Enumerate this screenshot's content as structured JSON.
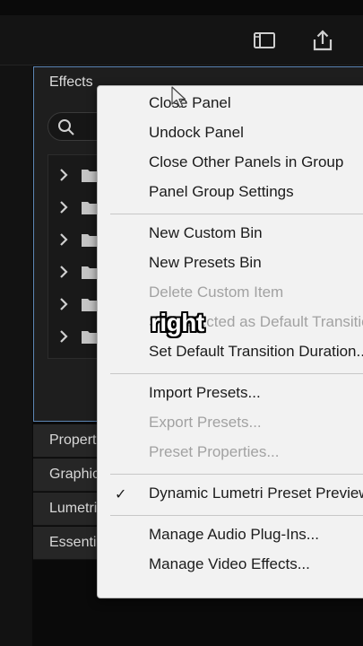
{
  "toolbar": {
    "icons": [
      "panel-layout-icon",
      "share-export-icon"
    ]
  },
  "effects_panel": {
    "title": "Effects",
    "search_icon": "search-icon",
    "tree_row_count": 6
  },
  "panel_tabs": [
    "Propert",
    "Graphic",
    "Lumetri",
    "Essenti"
  ],
  "context_menu": {
    "groups": [
      [
        {
          "label": "Close Panel",
          "enabled": true
        },
        {
          "label": "Undock Panel",
          "enabled": true
        },
        {
          "label": "Close Other Panels in Group",
          "enabled": true
        },
        {
          "label": "Panel Group Settings",
          "enabled": true
        }
      ],
      [
        {
          "label": "New Custom Bin",
          "enabled": true
        },
        {
          "label": "New Presets Bin",
          "enabled": true
        },
        {
          "label": "Delete Custom Item",
          "enabled": false
        },
        {
          "label": "Set Selected as Default Transition",
          "enabled": false
        },
        {
          "label": "Set Default Transition Duration...",
          "enabled": true
        }
      ],
      [
        {
          "label": "Import Presets...",
          "enabled": true
        },
        {
          "label": "Export Presets...",
          "enabled": false
        },
        {
          "label": "Preset Properties...",
          "enabled": false
        }
      ],
      [
        {
          "label": "Dynamic Lumetri Preset Previews",
          "enabled": true,
          "checked": true
        }
      ],
      [
        {
          "label": "Manage Audio Plug-Ins...",
          "enabled": true
        },
        {
          "label": "Manage Video Effects...",
          "enabled": true
        }
      ]
    ]
  },
  "caption": "right"
}
